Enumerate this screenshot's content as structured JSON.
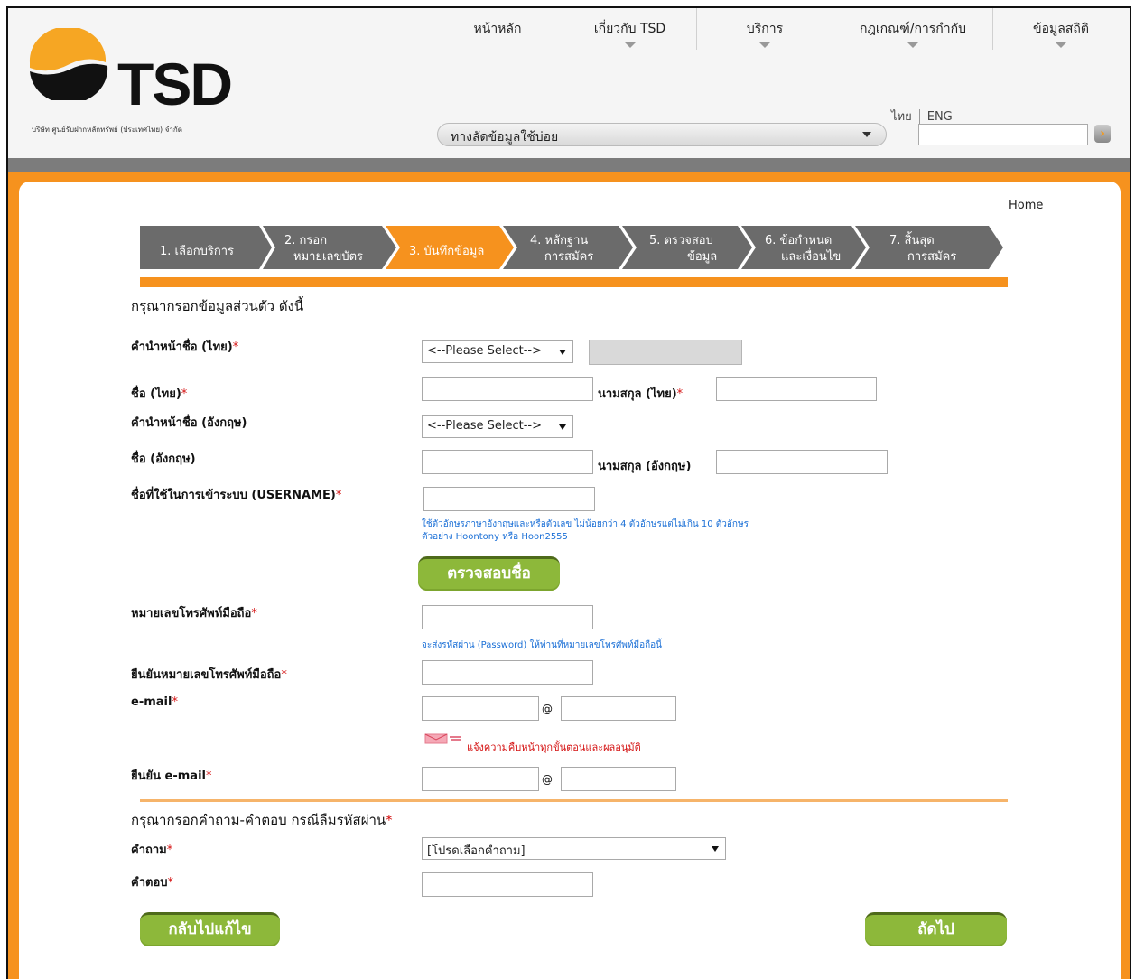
{
  "header": {
    "brand": "TSD",
    "company": "บริษัท ศูนย์รับฝากหลักทรัพย์ (ประเทศไทย) จำกัด",
    "nav": [
      {
        "label": "หน้าหลัก",
        "has_menu": false
      },
      {
        "label": "เกี่ยวกับ TSD",
        "has_menu": true
      },
      {
        "label": "บริการ",
        "has_menu": true
      },
      {
        "label": "กฎเกณฑ์/การกำกับ",
        "has_menu": true
      },
      {
        "label": "ข้อมูลสถิติ",
        "has_menu": true
      }
    ],
    "lang_th": "ไทย",
    "lang_en": "ENG",
    "shortcut_label": "ทางลัดข้อมูลใช้บ่อย",
    "search_value": ""
  },
  "breadcrumb": "Home",
  "steps": [
    {
      "line1": "1. เลือกบริการ",
      "line2": "",
      "active": false
    },
    {
      "line1": "2. กรอก",
      "line2": "หมายเลขบัตร",
      "active": false
    },
    {
      "line1": "3. บันทึกข้อมูล",
      "line2": "",
      "active": true
    },
    {
      "line1": "4. หลักฐาน",
      "line2": "การสมัคร",
      "active": false
    },
    {
      "line1": "5. ตรวจสอบ",
      "line2": "ข้อมูล",
      "active": false
    },
    {
      "line1": "6. ข้อกำหนด",
      "line2": "และเงื่อนไข",
      "active": false
    },
    {
      "line1": "7. สิ้นสุด",
      "line2": "การสมัคร",
      "active": false
    }
  ],
  "colors": {
    "active_step": "#f6921e",
    "inactive_step": "#6b6b6b",
    "accent": "#f6921e",
    "button": "#8db83a"
  },
  "form": {
    "section1_title": "กรุณากรอกข้อมูลส่วนตัว ดังนี้",
    "title_th_label": "คำนำหน้าชื่อ (ไทย)",
    "title_th_select": "<--Please Select-->",
    "first_name_th_label": "ชื่อ (ไทย)",
    "last_name_th_label": "นามสกุล (ไทย)",
    "title_en_label": "คำนำหน้าชื่อ (อังกฤษ)",
    "title_en_select": "<--Please Select-->",
    "first_name_en_label": "ชื่อ (อังกฤษ)",
    "last_name_en_label": "นามสกุล (อังกฤษ)",
    "username_label": "ชื่อที่ใช้ในการเข้าระบบ (USERNAME)",
    "username_hint1": "ใช้ตัวอักษรภาษาอังกฤษและหรือตัวเลข ไม่น้อยกว่า 4 ตัวอักษรแต่ไม่เกิน 10 ตัวอักษร",
    "username_hint2": "ตัวอย่าง Hoontony หรือ Hoon2555",
    "check_name_button": "ตรวจสอบชื่อ",
    "mobile_label": "หมายเลขโทรศัพท์มือถือ",
    "mobile_hint": "จะส่งรหัสผ่าน (Password) ให้ท่านที่หมายเลขโทรศัพท์มือถือนี้",
    "mobile_confirm_label": "ยืนยันหมายเลขโทรศัพท์มือถือ",
    "email_label": "e-mail",
    "at_sign": "@",
    "email_notice": "แจ้งความคืบหน้าทุกขั้นตอนและผลอนุมัติ",
    "email_confirm_label": "ยืนยัน e-mail",
    "section2_title": "กรุณากรอกคำถาม-คำตอบ กรณีลืมรหัสผ่าน",
    "question_label": "คำถาม",
    "question_select": "[โปรดเลือกคำถาม]",
    "answer_label": "คำตอบ",
    "back_button": "กลับไปแก้ไข",
    "next_button": "ถัดไป",
    "required_mark": "*"
  }
}
